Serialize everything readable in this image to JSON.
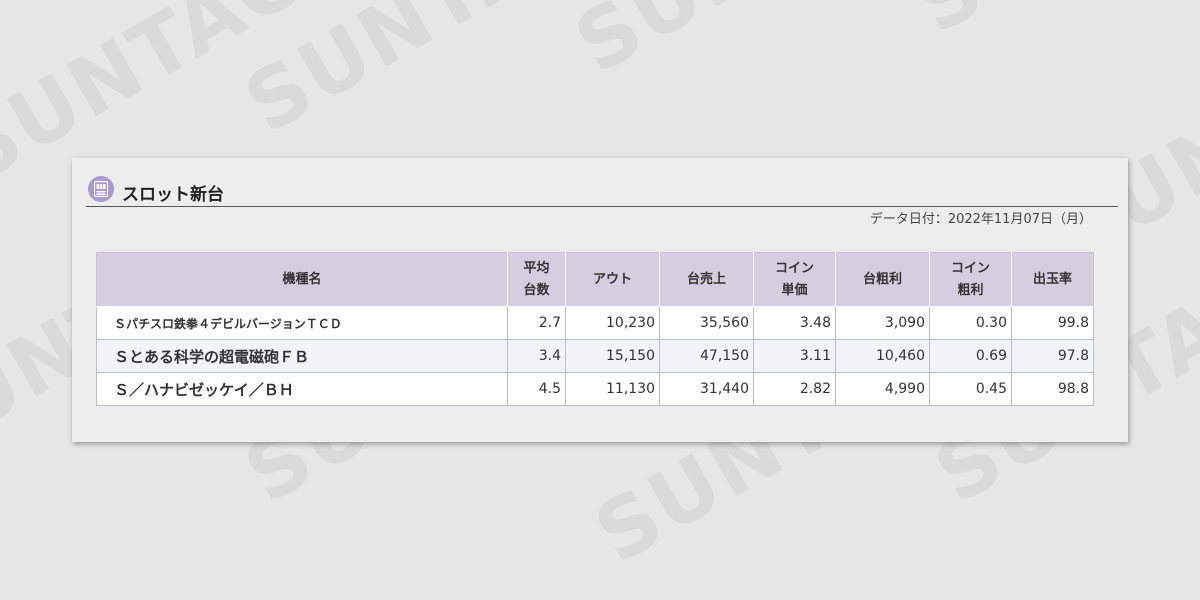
{
  "watermark": {
    "text": "SUNTAC"
  },
  "panel": {
    "title": "スロット新台",
    "icon": "slot-machine-icon",
    "data_date": "データ日付：2022年11月07日（月）"
  },
  "table": {
    "headers": [
      {
        "line1": "機種名",
        "line2": ""
      },
      {
        "line1": "平均",
        "line2": "台数"
      },
      {
        "line1": "アウト",
        "line2": ""
      },
      {
        "line1": "台売上",
        "line2": ""
      },
      {
        "line1": "コイン",
        "line2": "単価"
      },
      {
        "line1": "台粗利",
        "line2": ""
      },
      {
        "line1": "コイン",
        "line2": "粗利"
      },
      {
        "line1": "出玉率",
        "line2": ""
      }
    ],
    "rows": [
      {
        "name": "Ｓパチスロ鉄拳４デビルバージョンＴＣＤ",
        "avg_units": "2.7",
        "out": "10,230",
        "sales": "35,560",
        "coin_price": "3.48",
        "gross_profit": "3,090",
        "coin_profit": "0.30",
        "payout_rate": "99.8"
      },
      {
        "name": "Ｓとある科学の超電磁砲ＦＢ",
        "avg_units": "3.4",
        "out": "15,150",
        "sales": "47,150",
        "coin_price": "3.11",
        "gross_profit": "10,460",
        "coin_profit": "0.69",
        "payout_rate": "97.8"
      },
      {
        "name": "Ｓ／ハナビゼッケイ／ＢＨ",
        "avg_units": "4.5",
        "out": "11,130",
        "sales": "31,440",
        "coin_price": "2.82",
        "gross_profit": "4,990",
        "coin_profit": "0.45",
        "payout_rate": "98.8"
      }
    ]
  },
  "colors": {
    "background": "#e6e6e6",
    "panel": "#ededed",
    "header_bg": "#d4cfe0",
    "icon_bg": "#a79bd4",
    "alt_row": "#f2f4f8"
  }
}
